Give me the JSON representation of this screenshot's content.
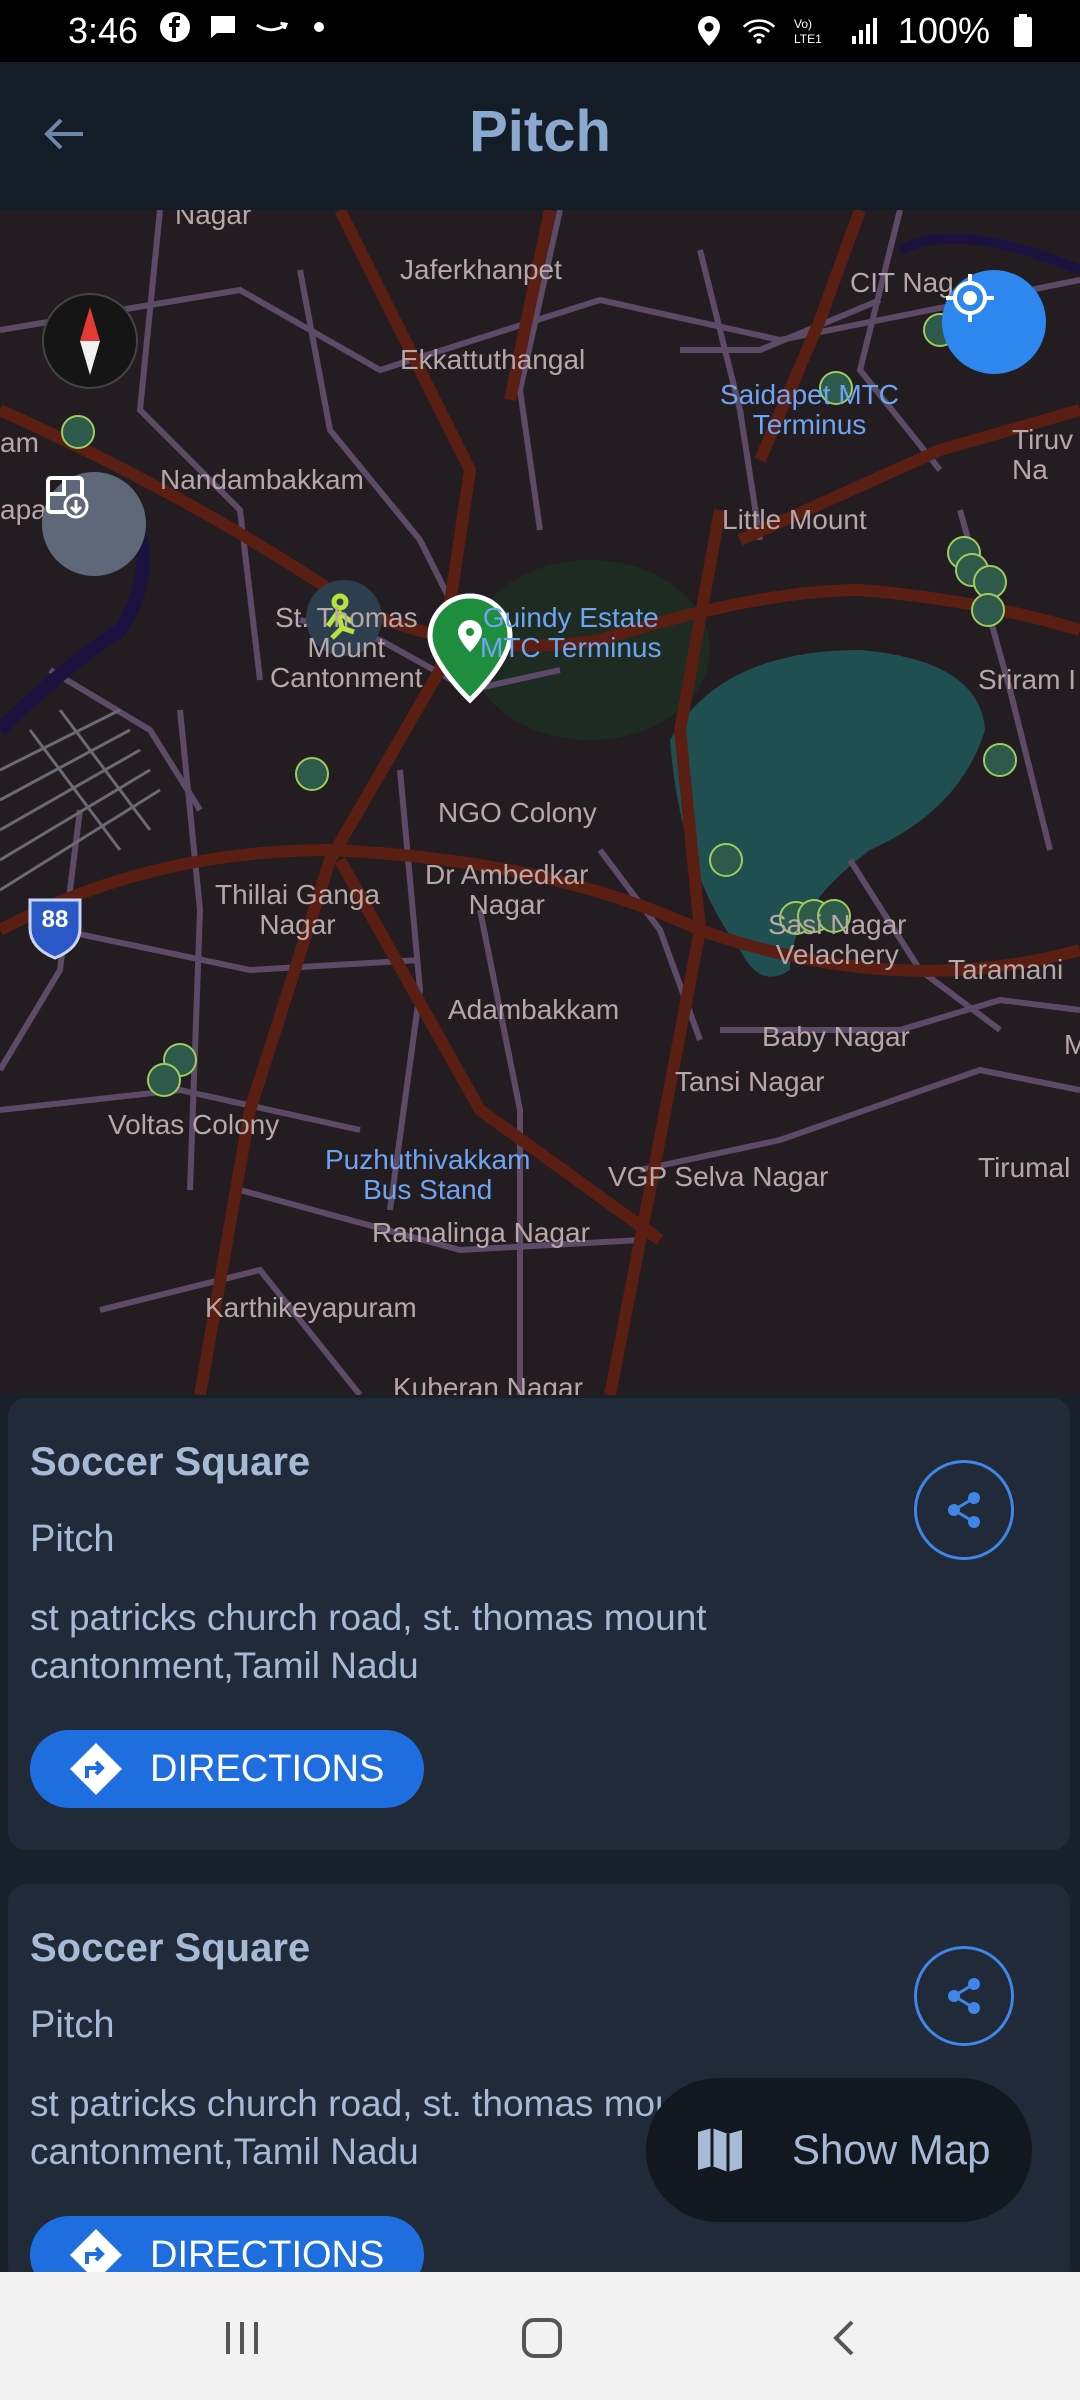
{
  "status_bar": {
    "time": "3:46",
    "battery": "100%",
    "icons": [
      "facebook-icon",
      "message-icon",
      "amazon-icon",
      "dot-icon",
      "location-icon",
      "wifi-icon",
      "volte-icon",
      "signal-icon",
      "battery-icon"
    ]
  },
  "app_bar": {
    "title": "Pitch",
    "back_icon": "arrow-left-icon"
  },
  "map": {
    "labels": [
      {
        "text": "Nagar",
        "blue": false
      },
      {
        "text": "Jaferkhanpet",
        "blue": false
      },
      {
        "text": "CIT Nag",
        "blue": false
      },
      {
        "text": "Ekkattuthangal",
        "blue": false
      },
      {
        "text": "Saidapet MTC\nTerminus",
        "blue": true
      },
      {
        "text": "Tiruv\nNa",
        "blue": false
      },
      {
        "text": "am",
        "blue": false
      },
      {
        "text": "Nandambakkam",
        "blue": false
      },
      {
        "text": "apal",
        "blue": false
      },
      {
        "text": "Little Mount",
        "blue": false
      },
      {
        "text": "St. Thomas\nMount\nCantonment",
        "blue": false
      },
      {
        "text": "Guindy Estate\nMTC Terminus",
        "blue": true
      },
      {
        "text": "Sriram I",
        "blue": false
      },
      {
        "text": "NGO Colony",
        "blue": false
      },
      {
        "text": "Dr Ambedkar\nNagar",
        "blue": false
      },
      {
        "text": "Thillai Ganga\nNagar",
        "blue": false
      },
      {
        "text": "Sasi Nagar\nVelachery",
        "blue": false
      },
      {
        "text": "Taramani",
        "blue": false
      },
      {
        "text": "Adambakkam",
        "blue": false
      },
      {
        "text": "Baby Nagar",
        "blue": false
      },
      {
        "text": "M",
        "blue": false
      },
      {
        "text": "Tansi Nagar",
        "blue": false
      },
      {
        "text": "Voltas Colony",
        "blue": false
      },
      {
        "text": "Puzhuthivakkam\nBus Stand",
        "blue": true
      },
      {
        "text": "VGP Selva Nagar",
        "blue": false
      },
      {
        "text": "Tirumal",
        "blue": false
      },
      {
        "text": "Ramalinga Nagar",
        "blue": false
      },
      {
        "text": "Karthikeyapuram",
        "blue": false
      },
      {
        "text": "Kuberan Nagar",
        "blue": false
      }
    ],
    "highway_shield": "88",
    "compass_icon": "compass-icon",
    "layers_icon": "layers-icon",
    "locate_icon": "my-location-icon"
  },
  "results": [
    {
      "name": "Soccer Square",
      "type": "Pitch",
      "address": "st patricks church road, st. thomas mount cantonment,Tamil Nadu",
      "directions_label": "DIRECTIONS"
    },
    {
      "name": "Soccer Square",
      "type": "Pitch",
      "address": "st patricks church road, st. thomas mount cantonment,Tamil Nadu",
      "directions_label": "DIRECTIONS"
    }
  ],
  "show_map": {
    "label": "Show Map",
    "icon": "map-icon"
  },
  "nav_bar": {
    "icons": [
      "recents-icon",
      "home-icon",
      "back-icon"
    ]
  },
  "colors": {
    "accent": "#2e86ef",
    "card_bg": "#212a38",
    "text": "#a6bad6",
    "pin_green": "#1e8e3e"
  }
}
